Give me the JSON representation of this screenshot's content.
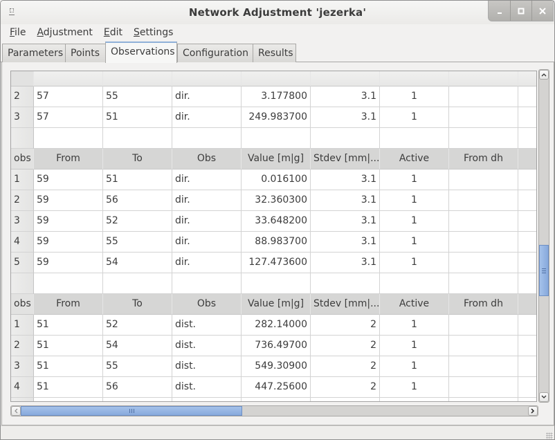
{
  "window": {
    "title": "Network Adjustment 'jezerka'",
    "controls": [
      "minimize",
      "maximize",
      "close"
    ]
  },
  "menubar": {
    "items": [
      {
        "label": "File",
        "mnemonic": "F",
        "rest": "ile"
      },
      {
        "label": "Adjustment",
        "mnemonic": "A",
        "rest": "djustment"
      },
      {
        "label": "Edit",
        "mnemonic": "E",
        "rest": "dit"
      },
      {
        "label": "Settings",
        "mnemonic": "S",
        "rest": "ettings"
      }
    ]
  },
  "tabs": [
    {
      "label": "Parameters",
      "active": false
    },
    {
      "label": "Points",
      "active": false
    },
    {
      "label": "Observations",
      "active": true
    },
    {
      "label": "Configuration",
      "active": false
    },
    {
      "label": "Results",
      "active": false
    }
  ],
  "table": {
    "columns": [
      "obs",
      "From",
      "To",
      "Obs",
      "Value [m|g]",
      "Stdev [mm|...",
      "Active",
      "From dh",
      ""
    ],
    "blocks": [
      {
        "show_header": false,
        "rows": [
          {
            "n": "2",
            "from": "57",
            "to": "55",
            "obs": "dir.",
            "value": "3.177800",
            "stdev": "3.1",
            "active": "1",
            "from_dh": ""
          },
          {
            "n": "3",
            "from": "57",
            "to": "51",
            "obs": "dir.",
            "value": "249.983700",
            "stdev": "3.1",
            "active": "1",
            "from_dh": ""
          }
        ]
      },
      {
        "show_header": true,
        "rows": [
          {
            "n": "1",
            "from": "59",
            "to": "51",
            "obs": "dir.",
            "value": "0.016100",
            "stdev": "3.1",
            "active": "1",
            "from_dh": ""
          },
          {
            "n": "2",
            "from": "59",
            "to": "56",
            "obs": "dir.",
            "value": "32.360300",
            "stdev": "3.1",
            "active": "1",
            "from_dh": ""
          },
          {
            "n": "3",
            "from": "59",
            "to": "52",
            "obs": "dir.",
            "value": "33.648200",
            "stdev": "3.1",
            "active": "1",
            "from_dh": ""
          },
          {
            "n": "4",
            "from": "59",
            "to": "55",
            "obs": "dir.",
            "value": "88.983700",
            "stdev": "3.1",
            "active": "1",
            "from_dh": ""
          },
          {
            "n": "5",
            "from": "59",
            "to": "54",
            "obs": "dir.",
            "value": "127.473600",
            "stdev": "3.1",
            "active": "1",
            "from_dh": ""
          }
        ]
      },
      {
        "show_header": true,
        "rows": [
          {
            "n": "1",
            "from": "51",
            "to": "52",
            "obs": "dist.",
            "value": "282.14000",
            "stdev": "2",
            "active": "1",
            "from_dh": ""
          },
          {
            "n": "2",
            "from": "51",
            "to": "54",
            "obs": "dist.",
            "value": "736.49700",
            "stdev": "2",
            "active": "1",
            "from_dh": ""
          },
          {
            "n": "3",
            "from": "51",
            "to": "55",
            "obs": "dist.",
            "value": "549.30900",
            "stdev": "2",
            "active": "1",
            "from_dh": ""
          },
          {
            "n": "4",
            "from": "51",
            "to": "56",
            "obs": "dist.",
            "value": "447.25600",
            "stdev": "2",
            "active": "1",
            "from_dh": ""
          }
        ]
      }
    ]
  },
  "scrollbars": {
    "vertical_position": 0.62,
    "horizontal_position": 0.0
  }
}
